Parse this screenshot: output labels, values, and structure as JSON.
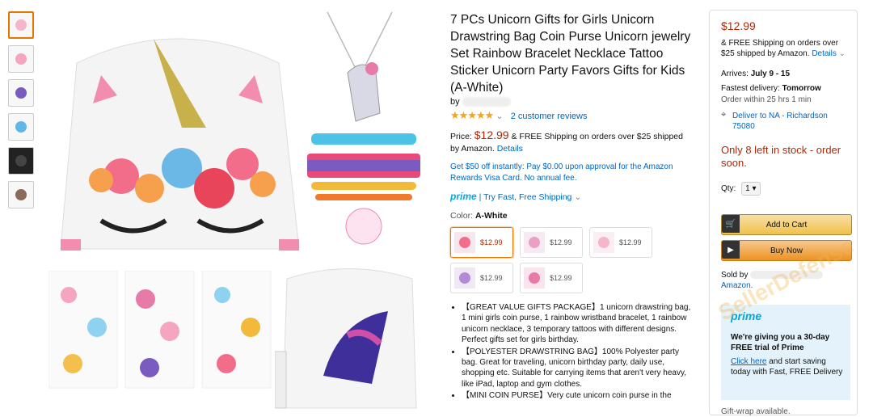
{
  "product": {
    "title": "7 PCs Unicorn Gifts for Girls Unicorn Drawstring Bag Coin Purse Unicorn jewelry Set Rainbow Bracelet Necklace Tattoo Sticker Unicorn Party Favors Gifts for Kids (A-White)",
    "by_label": "by",
    "reviews_link": "2 customer reviews",
    "price_label": "Price:",
    "price": "$12.99",
    "shipping_text": "& FREE Shipping on orders over $25 shipped by Amazon.",
    "details_link": "Details",
    "promo": "Get $50 off instantly: Pay $0.00 upon approval for the Amazon Rewards Visa Card. No annual fee.",
    "prime_label": "prime",
    "prime_text": "| Try Fast, Free Shipping",
    "color_label": "Color:",
    "color_value": "A-White",
    "swatches": [
      "$12.99",
      "$12.99",
      "$12.99",
      "$12.99",
      "$12.99"
    ],
    "bullets": [
      "【GREAT VALUE GIFTS PACKAGE】1 unicorn drawstring bag, 1 mini girls coin purse, 1 rainbow wristband bracelet, 1 rainbow unicorn necklace, 3 temporary tattoos with different designs. Perfect gifts set for girls birthday.",
      "【POLYESTER DRAWSTRING BAG】100% Polyester party bag. Great for traveling, unicorn birthday party, daily use, shopping etc. Suitable for carrying items that aren't very heavy, like iPad, laptop and gym clothes.",
      "【MINI COIN PURSE】Very cute unicorn coin purse in the"
    ]
  },
  "buybox": {
    "price": "$12.99",
    "shipping": "& FREE Shipping on orders over $25 shipped by Amazon.",
    "details": "Details",
    "arrives_label": "Arrives:",
    "arrives": "July 9 - 15",
    "fastest_label": "Fastest delivery:",
    "fastest": "Tomorrow",
    "order_within": "Order within 25 hrs 1 min",
    "deliver_to": "Deliver to NA - Richardson 75080",
    "stock": "Only 8 left in stock - order soon.",
    "qty_label": "Qty:",
    "qty": "1",
    "add_to_cart": "Add to Cart",
    "buy_now": "Buy Now",
    "sold_by": "Sold by",
    "sold_by_amazon": "Amazon.",
    "prime_logo": "prime",
    "prime_offer_title": "We're giving you a 30-day FREE trial of Prime",
    "click_here": "Click here",
    "prime_offer_rest": "and start saving today with Fast, FREE Delivery",
    "gift_wrap": "Gift-wrap available."
  },
  "watermark": "SellerDefense",
  "colors": {
    "price": "#b12704",
    "link": "#0066c0",
    "cart": "#f0c14b",
    "buy": "#ed9220"
  }
}
